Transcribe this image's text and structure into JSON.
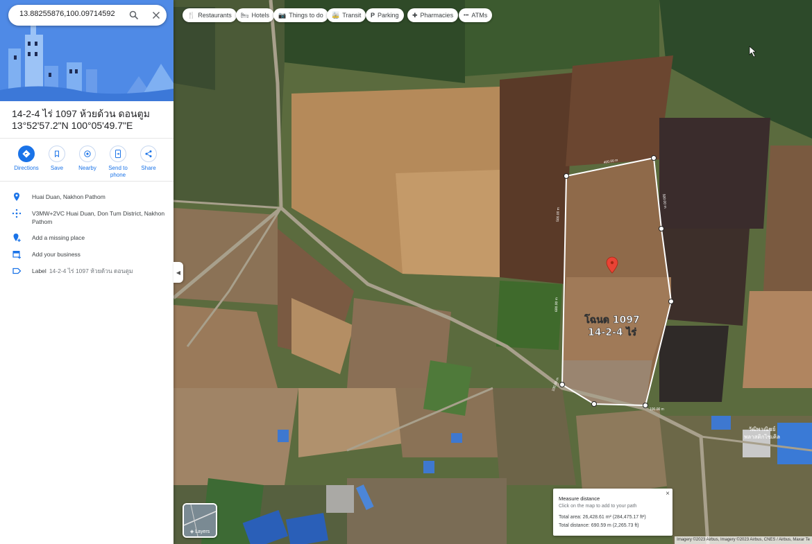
{
  "search": {
    "value": "13.88255876,100.09714592"
  },
  "place": {
    "name": "14-2-4 ไร่ 1097 ห้วยด้วน ดอนตูม",
    "coords": "13°52'57.2\"N 100°05'49.7\"E"
  },
  "actions": [
    {
      "label": "Directions",
      "icon": "directions-icon"
    },
    {
      "label": "Save",
      "icon": "bookmark-icon"
    },
    {
      "label": "Nearby",
      "icon": "nearby-icon"
    },
    {
      "label": "Send to phone",
      "icon": "send-to-phone-icon"
    },
    {
      "label": "Share",
      "icon": "share-icon"
    }
  ],
  "info": {
    "location": "Huai Duan, Nakhon Pathom",
    "plus_code": "V3MW+2VC Huai Duan, Don Tum District, Nakhon Pathom",
    "add_place": "Add a missing place",
    "add_business": "Add your business",
    "label_title": "Label",
    "label_value": "14-2-4 ไร่ 1097 ห้วยด้วน ดอนตูม"
  },
  "chips": [
    {
      "label": "Restaurants",
      "icon": "restaurant-icon"
    },
    {
      "label": "Hotels",
      "icon": "hotel-icon"
    },
    {
      "label": "Things to do",
      "icon": "camera-icon"
    },
    {
      "label": "Transit",
      "icon": "transit-icon"
    },
    {
      "label": "Parking",
      "icon": "parking-icon"
    },
    {
      "label": "Pharmacies",
      "icon": "pharmacy-icon"
    },
    {
      "label": "ATMs",
      "icon": "atm-icon"
    }
  ],
  "map": {
    "plot_label_line1": "โฉนด 1097",
    "plot_label_line2": "14-2-4 ไร่",
    "edge_labels": [
      "400.00 m",
      "500.00 m",
      "600.00 m",
      "500.00 m",
      "100.00 m",
      "100.00 m"
    ],
    "village_label_line1": "วัฒิพาณิชย์",
    "village_label_line2": "พลาสติกไซเคิล"
  },
  "layers": {
    "label": "Layers"
  },
  "measure": {
    "title": "Measure distance",
    "hint": "Click on the map to add to your path",
    "area": "Total area: 26,428.61 m² (284,475.17 ft²)",
    "distance": "Total distance: 690.59 m (2,265.73 ft)"
  },
  "credit": "Imagery ©2023 Airbus, Imagery ©2023 Airbus, CNES / Airbus, Maxar Te",
  "colors": {
    "accent": "#1a73e8",
    "pin": "#ea4335"
  }
}
